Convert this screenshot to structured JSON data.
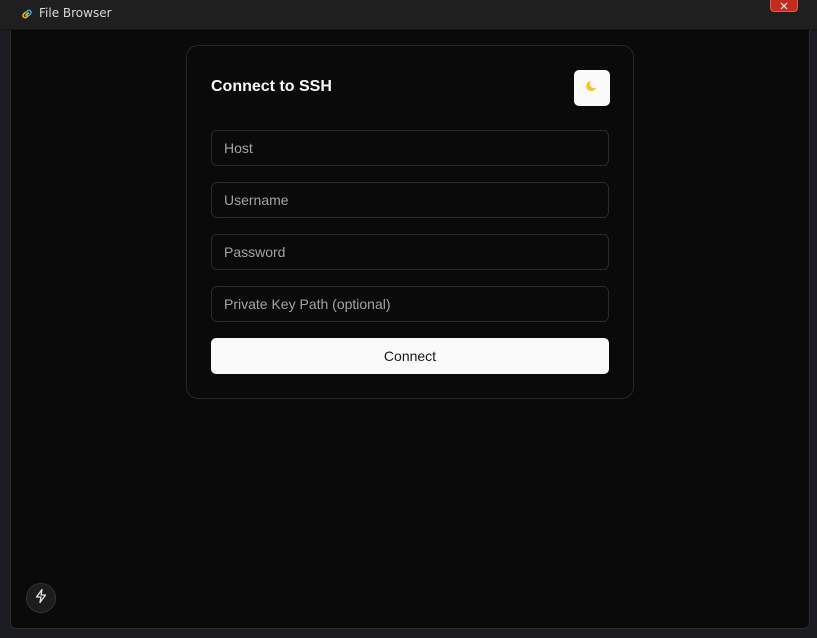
{
  "window": {
    "title": "File Browser",
    "app_icon": "link-icon",
    "close_icon": "close-icon"
  },
  "form": {
    "title": "Connect to SSH",
    "theme_toggle_icon": "moon-icon",
    "fields": [
      {
        "name": "host",
        "placeholder": "Host",
        "value": ""
      },
      {
        "name": "username",
        "placeholder": "Username",
        "value": ""
      },
      {
        "name": "password",
        "placeholder": "Password",
        "value": ""
      },
      {
        "name": "private_key_path",
        "placeholder": "Private Key Path (optional)",
        "value": ""
      }
    ],
    "submit_label": "Connect"
  },
  "floating_action": {
    "icon": "lightning-bolt-icon"
  },
  "colors": {
    "background": "#0a0a0a",
    "primary_button": "#fafafa",
    "close_button": "#c42b1c",
    "moon": "#f5c518"
  }
}
